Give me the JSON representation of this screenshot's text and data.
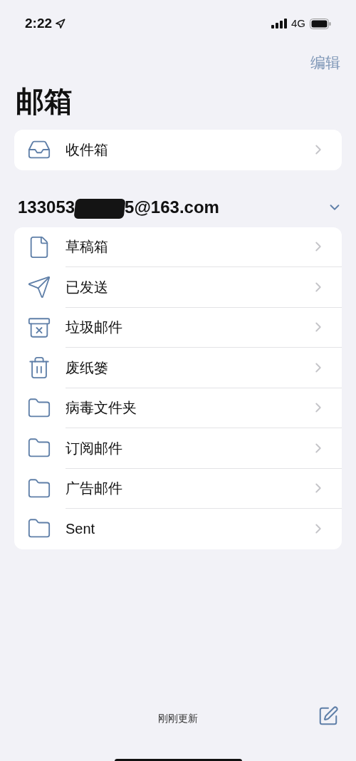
{
  "status_bar": {
    "time": "2:22",
    "network": "4G"
  },
  "nav": {
    "edit": "编辑"
  },
  "title": "邮箱",
  "top_mailboxes": [
    {
      "label": "收件箱",
      "kind": "inbox"
    }
  ],
  "account": {
    "address_start": "133053",
    "address_end": "5@163.com",
    "expanded": true
  },
  "folders": [
    {
      "label": "草稿箱",
      "kind": "draft"
    },
    {
      "label": "已发送",
      "kind": "sent"
    },
    {
      "label": "垃圾邮件",
      "kind": "junk"
    },
    {
      "label": "废纸篓",
      "kind": "trash"
    },
    {
      "label": "病毒文件夹",
      "kind": "folder"
    },
    {
      "label": "订阅邮件",
      "kind": "folder"
    },
    {
      "label": "广告邮件",
      "kind": "folder"
    },
    {
      "label": "Sent",
      "kind": "folder"
    }
  ],
  "footer": {
    "status": "刚刚更新"
  }
}
